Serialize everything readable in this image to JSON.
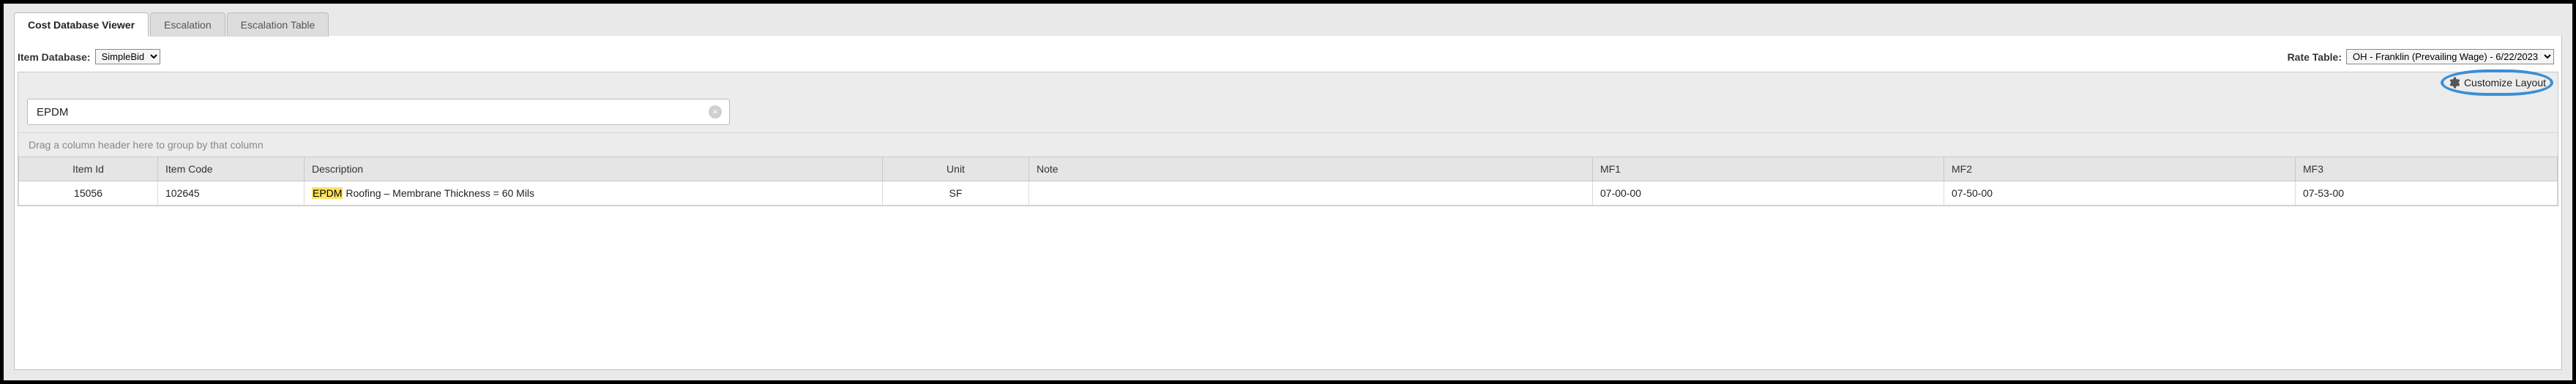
{
  "tabs": [
    {
      "label": "Cost Database Viewer",
      "active": true
    },
    {
      "label": "Escalation",
      "active": false
    },
    {
      "label": "Escalation Table",
      "active": false
    }
  ],
  "item_database": {
    "label": "Item Database:",
    "selected": "SimpleBid"
  },
  "rate_table": {
    "label": "Rate Table:",
    "selected": "OH - Franklin (Prevailing Wage) - 6/22/2023"
  },
  "customize_label": "Customize Layout",
  "search": {
    "value": "EPDM",
    "placeholder": ""
  },
  "group_hint": "Drag a column header here to group by that column",
  "columns": {
    "item_id": "Item Id",
    "item_code": "Item Code",
    "description": "Description",
    "unit": "Unit",
    "note": "Note",
    "mf1": "MF1",
    "mf2": "MF2",
    "mf3": "MF3"
  },
  "rows": [
    {
      "item_id": "15056",
      "item_code": "102645",
      "desc_highlight": "EPDM",
      "desc_rest": " Roofing – Membrane Thickness = 60 Mils",
      "unit": "SF",
      "note": "",
      "mf1": "07-00-00",
      "mf2": "07-50-00",
      "mf3": "07-53-00"
    }
  ]
}
